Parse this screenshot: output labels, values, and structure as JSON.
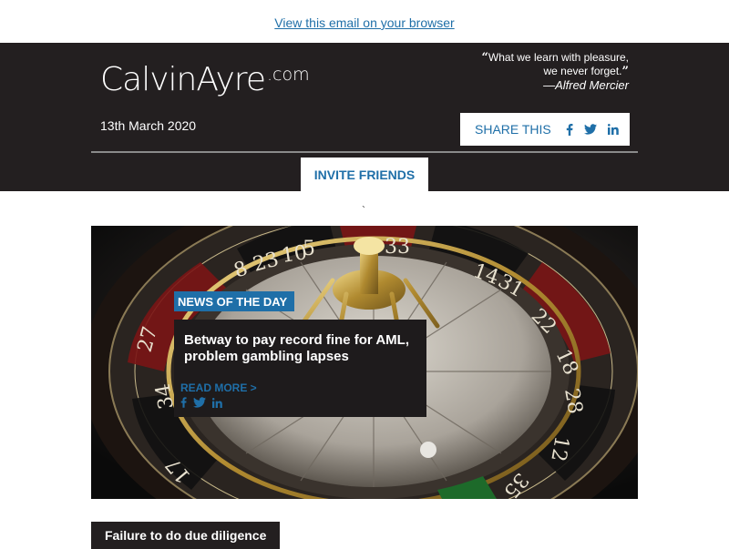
{
  "topbar": {
    "view_in_browser": "View this email on your browser"
  },
  "header": {
    "logo_main": "CalvinAyre",
    "logo_suffix": ".com",
    "quote_open": "“",
    "quote_line1": "What we learn with pleasure,",
    "quote_line2": "we never forget.",
    "quote_close": "”",
    "quote_author": "—Alfred Mercier",
    "date": "13th March 2020",
    "share_label": "SHARE THIS",
    "share_icons": [
      "facebook-icon",
      "twitter-icon",
      "linkedin-icon"
    ],
    "invite_label": "INVITE FRIENDS"
  },
  "separator": "`",
  "hero": {
    "tag": "NEWS OF THE DAY",
    "title": "Betway to pay record fine for AML, problem gambling lapses",
    "read_more": "READ MORE >",
    "social_icons": [
      "facebook-icon",
      "twitter-icon",
      "linkedin-icon"
    ]
  },
  "next_article": {
    "title": "Failure to do due diligence"
  },
  "colors": {
    "header_bg": "#231f20",
    "accent_blue": "#1f6fa8",
    "white": "#ffffff"
  }
}
